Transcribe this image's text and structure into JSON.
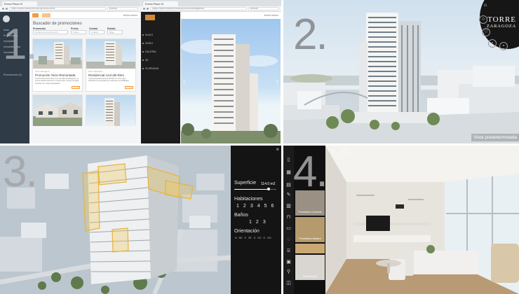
{
  "panels": {
    "p1": {
      "number": "1.",
      "window_a": {
        "tab": "Evera Plaza III",
        "url": "https://www.localhost:8080/promociones",
        "search_placeholder": "Buscar",
        "top_link": "Iniciar sesión",
        "sidebar_items": [
          "Inicio",
          "Promociones",
          "Inmuebles",
          "Inmuebles obra",
          "Inmuebles",
          "Promociones (3)"
        ],
        "page_title": "Buscador de promociones",
        "filters": [
          {
            "label": "Promoción",
            "value": "Nombre de la promoción"
          },
          {
            "label": "Precio",
            "value": "Precio"
          },
          {
            "label": "Ciudad",
            "value": "Ciudad"
          },
          {
            "label": "Estado",
            "value": "Elige"
          }
        ],
        "cards": [
          {
            "sub": "Torre Zaragoza",
            "title": "Promoción Torre Remontada",
            "text": "Cuenta Promoción 90 en la zona alta de Zaragoza, en la que podrás reservar tu nueva casa. Incluye amplias terrazas con vistas despejadas.",
            "button": "Ver más"
          },
          {
            "sub": "Torre Zaragoza",
            "title": "Residencial Azul del Ebro",
            "text": "Cuenta Residencial Azul del Ebro con la mejor ubicación de la ciudad con todas las comodidades.",
            "button": "Ver más"
          },
          {
            "sub": "",
            "title": "",
            "text": "",
            "button": ""
          },
          {
            "sub": "",
            "title": "",
            "text": "",
            "button": ""
          }
        ]
      },
      "window_b": {
        "tab": "Evera Plaza III",
        "url": "https://www.localhost:8080/promociones/galeria",
        "search_placeholder": "Buscar",
        "top_link": "Iniciar sesión",
        "menu": [
          "INICIO",
          "VIDEO",
          "GALERÍA",
          "3D",
          "VIVIENDAS"
        ]
      }
    },
    "p2": {
      "number": "2.",
      "brand_title": "TORRE",
      "brand_subtitle": "ZARAGOZA",
      "view_label": "Vista predeterminada"
    },
    "p3": {
      "number": "3.",
      "superficie_label": "Superficie",
      "superficie_value": "114.0 m2",
      "superficie_level": 0.82,
      "habitaciones_label": "Habitaciones",
      "habitaciones_options": [
        "1",
        "2",
        "3",
        "4",
        "5",
        "6"
      ],
      "banos_label": "Baños",
      "banos_options": [
        "1",
        "2",
        "3"
      ],
      "orientacion_label": "Orientación",
      "orientacion_options": [
        "N",
        "NE",
        "E",
        "SE",
        "S",
        "SO",
        "O",
        "NO"
      ]
    },
    "p4": {
      "number": "4.",
      "swatches": [
        {
          "label": "Porcelánico Cemento",
          "color": "#9a9084"
        },
        {
          "label": "Porcelánico Madera",
          "color": "#b59a6e"
        },
        {
          "label": "",
          "color": "#caa874"
        },
        {
          "label": "Suelo Blanco",
          "color": "#d9d6d2"
        }
      ]
    }
  },
  "icons": {
    "home": "home-icon",
    "search": "search-icon",
    "heart": "heart-icon",
    "cube": "cube-icon",
    "close": "close-icon"
  }
}
